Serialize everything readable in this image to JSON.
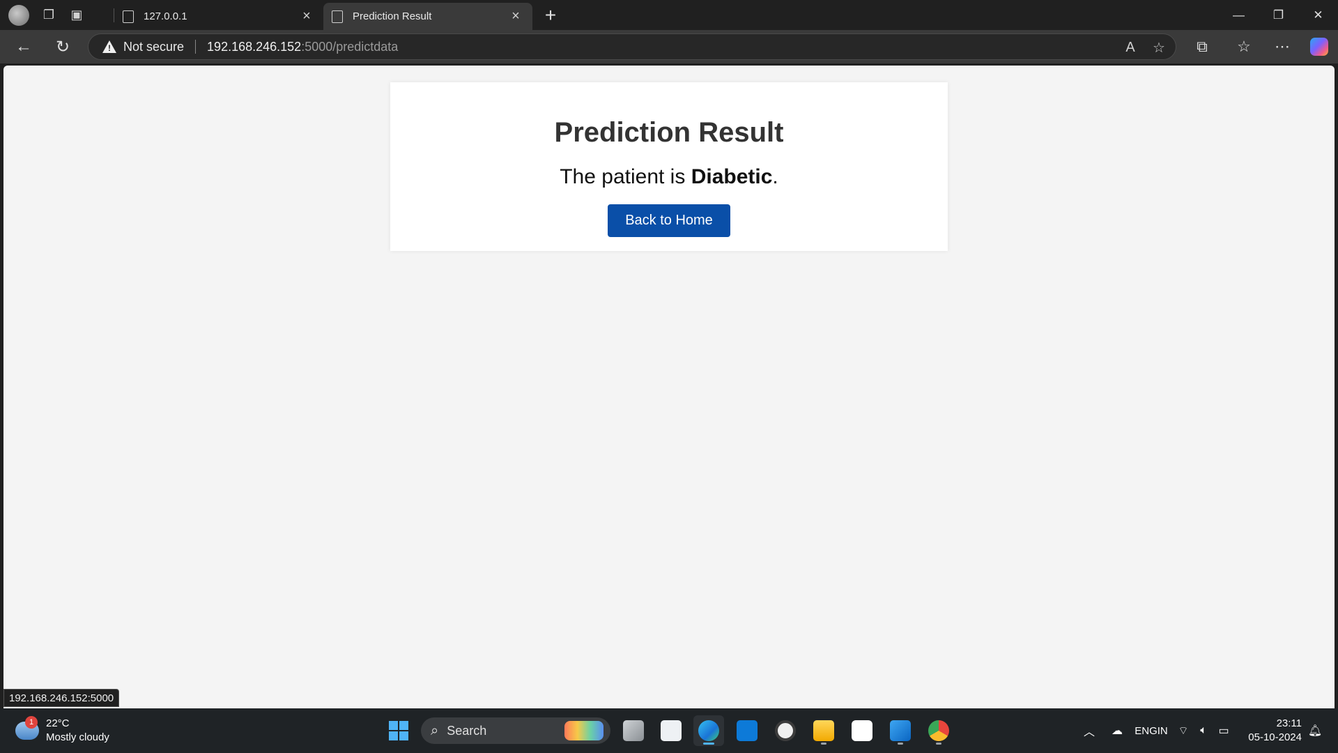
{
  "browser": {
    "tabs": [
      {
        "title": "127.0.0.1",
        "active": false
      },
      {
        "title": "Prediction Result",
        "active": true
      }
    ],
    "address": {
      "security_label": "Not secure",
      "host": "192.168.246.152",
      "path": ":5000/predictdata"
    },
    "status_url": "192.168.246.152:5000"
  },
  "page": {
    "heading": "Prediction Result",
    "result_prefix": "The patient is",
    "result_value": "Diabetic",
    "result_suffix": ".",
    "back_button_label": "Back to Home",
    "accent_color": "#0a4fa8"
  },
  "taskbar": {
    "weather": {
      "badge": "1",
      "temperature": "22°C",
      "condition": "Mostly cloudy"
    },
    "search_label": "Search",
    "language": {
      "line1": "ENG",
      "line2": "IN"
    },
    "clock": {
      "time": "23:11",
      "date": "05-10-2024"
    },
    "apps": [
      "task-view",
      "microsoft-store",
      "edge",
      "myhp",
      "wordpress",
      "file-explorer",
      "chatgpt",
      "vscode",
      "chrome"
    ]
  }
}
